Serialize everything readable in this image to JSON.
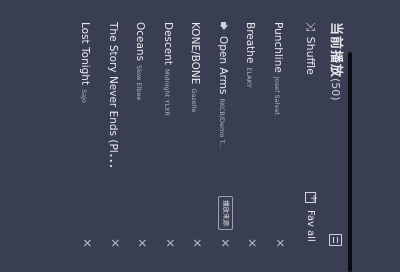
{
  "colors": {
    "background": "#3a3e52",
    "accent": "#0a0c14"
  },
  "header": {
    "title": "当前播放",
    "count": "(50)",
    "queue_icon": "queue-list-icon"
  },
  "controls": {
    "shuffle_label": "Shuffle",
    "shuffle_icon": "shuffle-icon",
    "fav_label": "Fav all",
    "fav_icon": "add-to-favorites-icon"
  },
  "songs": [
    {
      "title": "Punchline",
      "artist": "Josef Salvat",
      "playing": false,
      "tag": ""
    },
    {
      "title": "Breathe",
      "artist": "ELAKY",
      "playing": false,
      "tag": ""
    },
    {
      "title": "Open Arms",
      "artist": "RKCB/Demo T...",
      "playing": true,
      "tag": "播放来源"
    },
    {
      "title": "KONE/BONE",
      "artist": "Gazelle",
      "playing": false,
      "tag": ""
    },
    {
      "title": "Descent",
      "artist": "Midnight YLXR",
      "playing": false,
      "tag": ""
    },
    {
      "title": "Oceans",
      "artist": "Slow Elbee",
      "playing": false,
      "tag": ""
    },
    {
      "title": "The Story Never Ends (Pla...",
      "artist": "",
      "playing": false,
      "tag": ""
    },
    {
      "title": "Lost Tonight",
      "artist": "Sajo",
      "playing": false,
      "tag": ""
    }
  ]
}
